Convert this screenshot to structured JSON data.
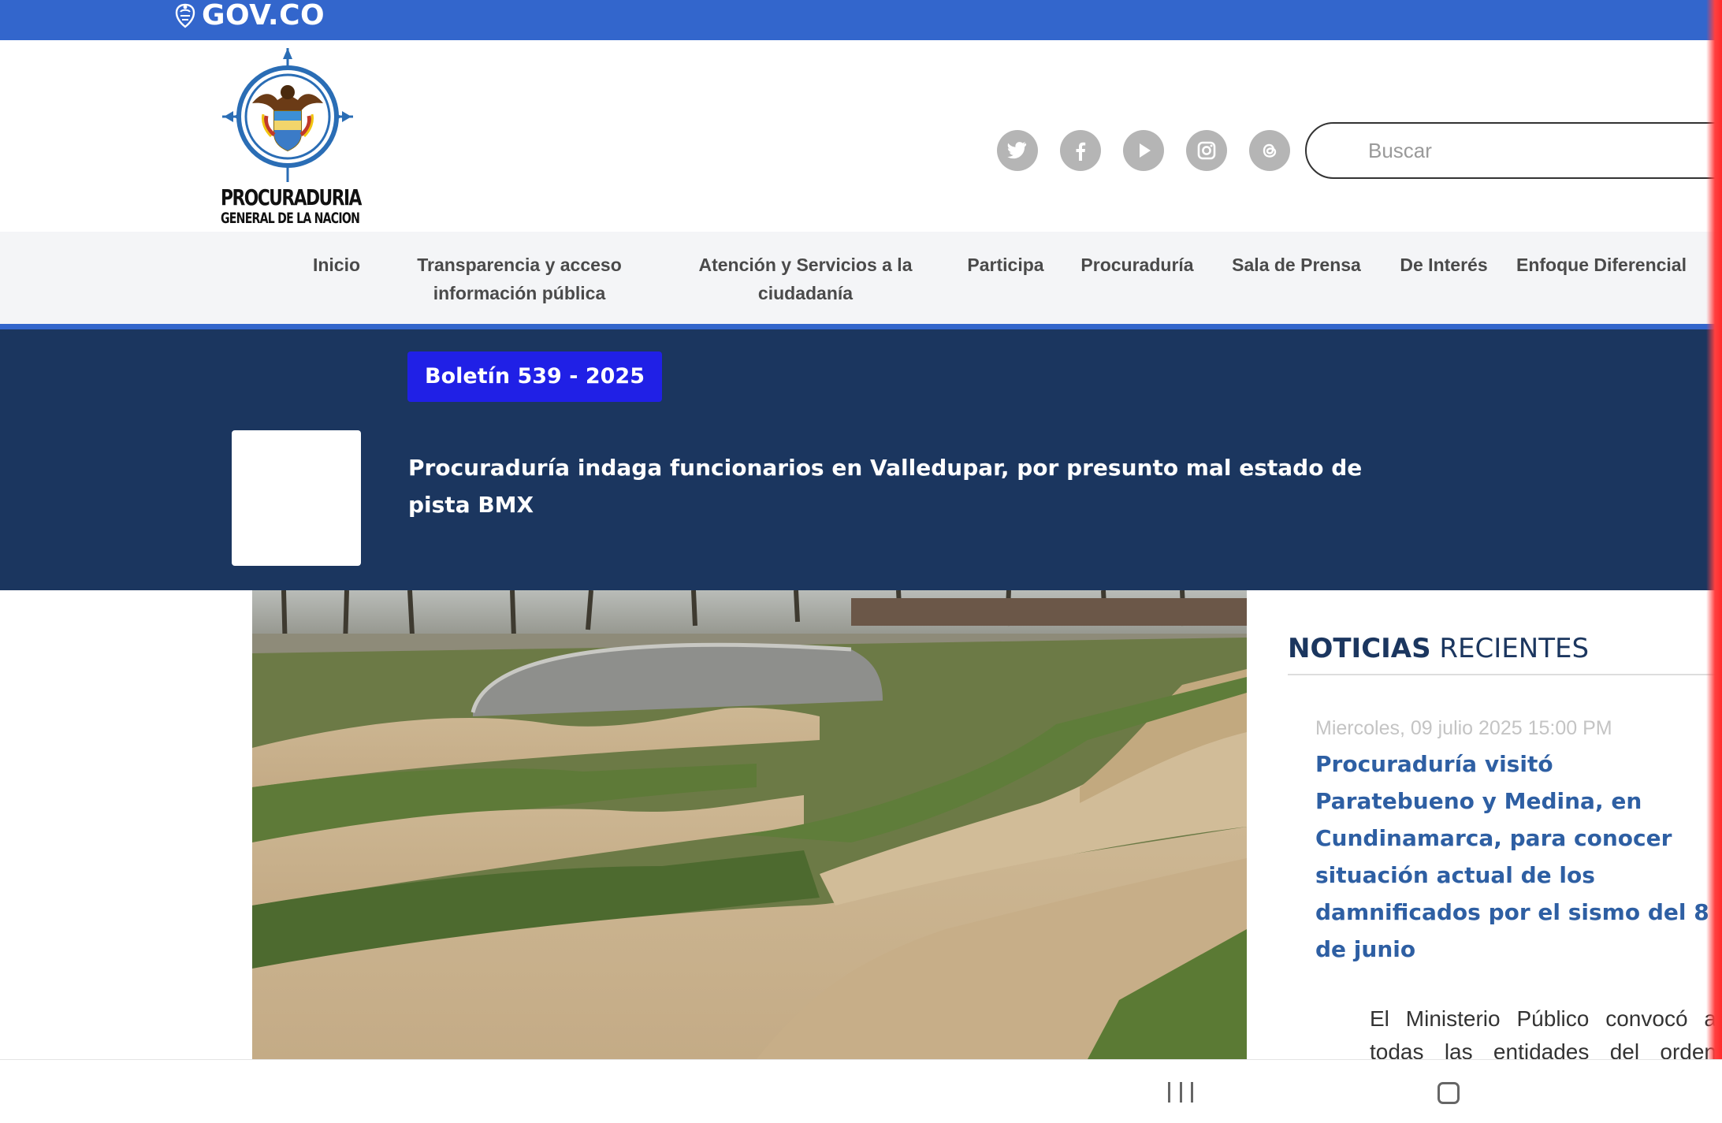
{
  "gov_bar": {
    "label": "GOV.CO",
    "color": "#3366cc"
  },
  "brand": {
    "name": "PROCURADURIA",
    "subname": "GENERAL DE LA NACION"
  },
  "social_icons": [
    "twitter-icon",
    "facebook-icon",
    "youtube-icon",
    "instagram-icon",
    "threads-icon"
  ],
  "search": {
    "placeholder": "Buscar"
  },
  "nav": {
    "items": [
      {
        "label": "Inicio"
      },
      {
        "label": "Transparencia y acceso información pública"
      },
      {
        "label": "Atención y Servicios a la ciudadanía"
      },
      {
        "label": "Participa"
      },
      {
        "label": "Procuraduría"
      },
      {
        "label": "Sala de Prensa"
      },
      {
        "label": "De Interés"
      },
      {
        "label": "Enfoque Diferencial"
      }
    ]
  },
  "banner": {
    "badge": "Boletín 539 - 2025",
    "headline": "Procuraduría indaga funcionarios en Valledupar, por presunto mal estado de pista BMX",
    "background": "#1b365f",
    "badge_color": "#2020e6"
  },
  "sidebar": {
    "title_strong": "NOTICIAS",
    "title_light": "RECIENTES",
    "news": [
      {
        "date": "Miercoles, 09 julio 2025 15:00 PM",
        "title": "Procuraduría visitó Paratebueno y Medina, en Cundinamarca, para conocer situación actual de los damnificados por el sismo del 8 de junio",
        "excerpt": "El Ministerio Público convocó a todas las entidades del orden nacional"
      }
    ]
  },
  "system_nav": {
    "buttons": [
      "recents-icon",
      "home-icon"
    ]
  }
}
